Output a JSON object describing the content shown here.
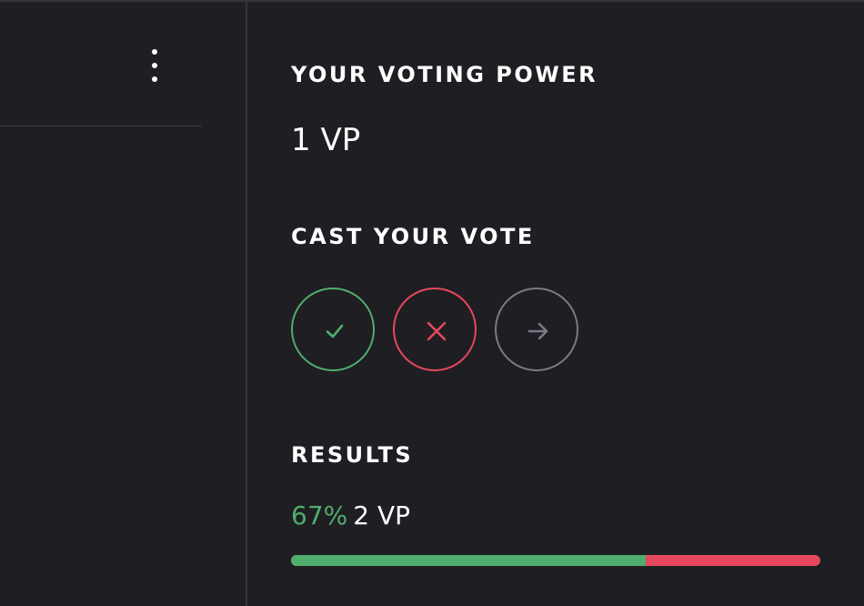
{
  "left_panel": {
    "menu_icon": "kebab-vertical-icon"
  },
  "voting_power": {
    "heading": "YOUR VOTING POWER",
    "value": "1 VP"
  },
  "cast_vote": {
    "heading": "CAST YOUR VOTE",
    "buttons": [
      {
        "icon": "check-icon",
        "color": "#4fad6e"
      },
      {
        "icon": "x-icon",
        "color": "#e5485c"
      },
      {
        "icon": "arrow-right-icon",
        "color": "#7b7a85"
      }
    ]
  },
  "results": {
    "heading": "RESULTS",
    "percent_label": "67%",
    "vp_label": "2 VP",
    "yes_fraction": 0.67,
    "colors": {
      "yes": "#4fad6e",
      "no": "#e5485c"
    }
  },
  "colors": {
    "background": "#1f1e23",
    "divider": "#35343a",
    "text": "#ffffff"
  }
}
